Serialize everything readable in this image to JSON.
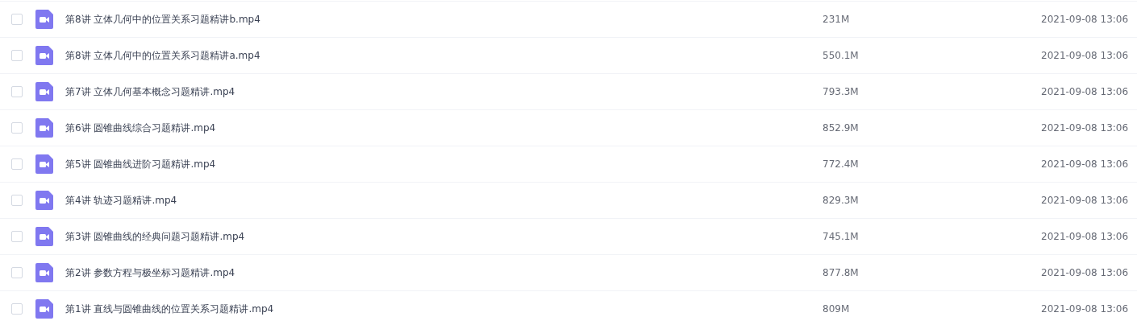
{
  "files": [
    {
      "name": "第8讲 立体几何中的位置关系习题精讲b.mp4",
      "size": "231M",
      "modified": "2021-09-08 13:06",
      "checked": false
    },
    {
      "name": "第8讲 立体几何中的位置关系习题精讲a.mp4",
      "size": "550.1M",
      "modified": "2021-09-08 13:06",
      "checked": false
    },
    {
      "name": "第7讲 立体几何基本概念习题精讲.mp4",
      "size": "793.3M",
      "modified": "2021-09-08 13:06",
      "checked": false
    },
    {
      "name": "第6讲 圆锥曲线综合习题精讲.mp4",
      "size": "852.9M",
      "modified": "2021-09-08 13:06",
      "checked": false
    },
    {
      "name": "第5讲 圆锥曲线进阶习题精讲.mp4",
      "size": "772.4M",
      "modified": "2021-09-08 13:06",
      "checked": false
    },
    {
      "name": "第4讲 轨迹习题精讲.mp4",
      "size": "829.3M",
      "modified": "2021-09-08 13:06",
      "checked": false
    },
    {
      "name": "第3讲 圆锥曲线的经典问题习题精讲.mp4",
      "size": "745.1M",
      "modified": "2021-09-08 13:06",
      "checked": false
    },
    {
      "name": "第2讲 参数方程与极坐标习题精讲.mp4",
      "size": "877.8M",
      "modified": "2021-09-08 13:06",
      "checked": false
    },
    {
      "name": "第1讲 直线与圆锥曲线的位置关系习题精讲.mp4",
      "size": "809M",
      "modified": "2021-09-08 13:06",
      "checked": false
    }
  ]
}
